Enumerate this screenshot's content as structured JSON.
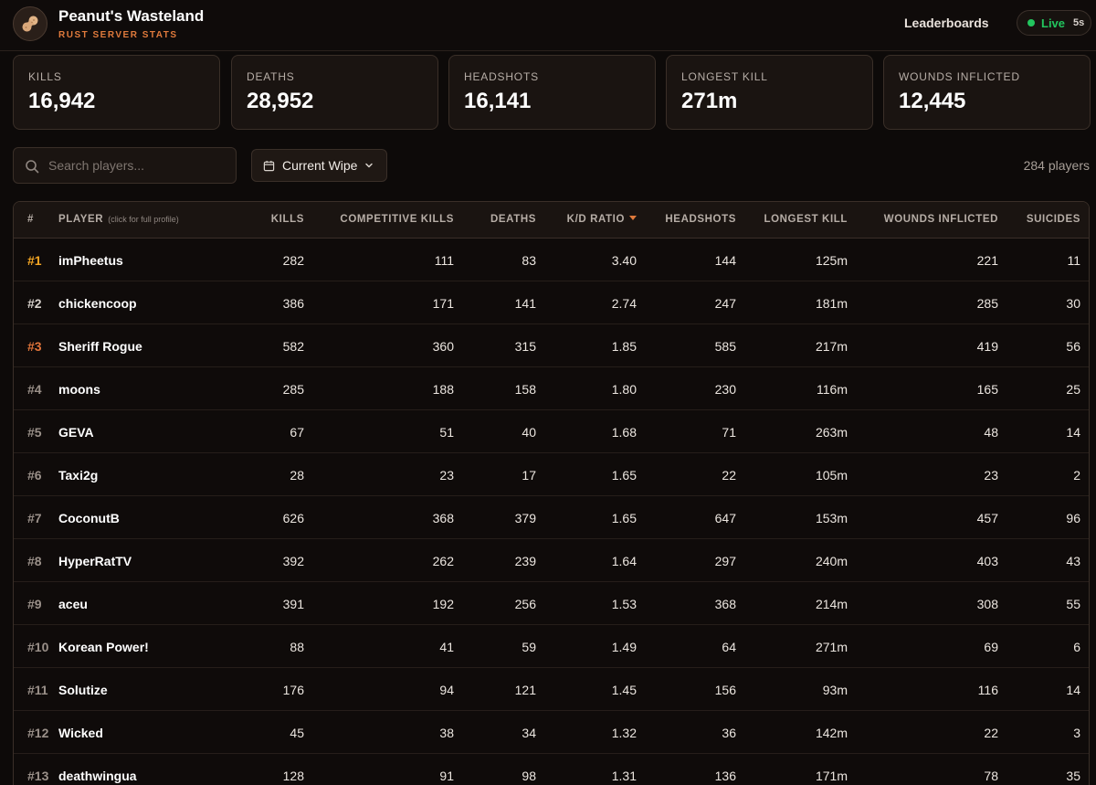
{
  "header": {
    "title": "Peanut's Wasteland",
    "subtitle": "RUST SERVER STATS",
    "nav_leaderboards": "Leaderboards",
    "live_label": "Live",
    "live_interval": "5s",
    "live_color": "#22c55e"
  },
  "stats": [
    {
      "label": "KILLS",
      "value": "16,942"
    },
    {
      "label": "DEATHS",
      "value": "28,952"
    },
    {
      "label": "HEADSHOTS",
      "value": "16,141"
    },
    {
      "label": "LONGEST KILL",
      "value": "271m"
    },
    {
      "label": "WOUNDS INFLICTED",
      "value": "12,445"
    }
  ],
  "controls": {
    "search_placeholder": "Search players...",
    "wipe_label": "Current Wipe",
    "player_count": "284 players"
  },
  "table": {
    "columns": {
      "rank": "#",
      "player": "PLAYER",
      "player_hint": "(click for full profile)",
      "kills": "KILLS",
      "competitive_kills": "COMPETITIVE KILLS",
      "deaths": "DEATHS",
      "kd": "K/D RATIO",
      "headshots": "HEADSHOTS",
      "longest_kill": "LONGEST KILL",
      "wounds": "WOUNDS INFLICTED",
      "suicides": "SUICIDES"
    },
    "sort_column": "K/D RATIO",
    "rows": [
      {
        "rank": "#1",
        "name": "imPheetus",
        "kills": "282",
        "comp": "111",
        "deaths": "83",
        "kd": "3.40",
        "hs": "144",
        "longest": "125m",
        "wounds": "221",
        "suicides": "11"
      },
      {
        "rank": "#2",
        "name": "chickencoop",
        "kills": "386",
        "comp": "171",
        "deaths": "141",
        "kd": "2.74",
        "hs": "247",
        "longest": "181m",
        "wounds": "285",
        "suicides": "30"
      },
      {
        "rank": "#3",
        "name": "Sheriff Rogue",
        "kills": "582",
        "comp": "360",
        "deaths": "315",
        "kd": "1.85",
        "hs": "585",
        "longest": "217m",
        "wounds": "419",
        "suicides": "56"
      },
      {
        "rank": "#4",
        "name": "moons",
        "kills": "285",
        "comp": "188",
        "deaths": "158",
        "kd": "1.80",
        "hs": "230",
        "longest": "116m",
        "wounds": "165",
        "suicides": "25"
      },
      {
        "rank": "#5",
        "name": "GEVA",
        "kills": "67",
        "comp": "51",
        "deaths": "40",
        "kd": "1.68",
        "hs": "71",
        "longest": "263m",
        "wounds": "48",
        "suicides": "14"
      },
      {
        "rank": "#6",
        "name": "Taxi2g",
        "kills": "28",
        "comp": "23",
        "deaths": "17",
        "kd": "1.65",
        "hs": "22",
        "longest": "105m",
        "wounds": "23",
        "suicides": "2"
      },
      {
        "rank": "#7",
        "name": "CoconutB",
        "kills": "626",
        "comp": "368",
        "deaths": "379",
        "kd": "1.65",
        "hs": "647",
        "longest": "153m",
        "wounds": "457",
        "suicides": "96"
      },
      {
        "rank": "#8",
        "name": "HyperRatTV",
        "kills": "392",
        "comp": "262",
        "deaths": "239",
        "kd": "1.64",
        "hs": "297",
        "longest": "240m",
        "wounds": "403",
        "suicides": "43"
      },
      {
        "rank": "#9",
        "name": "aceu",
        "kills": "391",
        "comp": "192",
        "deaths": "256",
        "kd": "1.53",
        "hs": "368",
        "longest": "214m",
        "wounds": "308",
        "suicides": "55"
      },
      {
        "rank": "#10",
        "name": "Korean Power!",
        "kills": "88",
        "comp": "41",
        "deaths": "59",
        "kd": "1.49",
        "hs": "64",
        "longest": "271m",
        "wounds": "69",
        "suicides": "6"
      },
      {
        "rank": "#11",
        "name": "Solutize",
        "kills": "176",
        "comp": "94",
        "deaths": "121",
        "kd": "1.45",
        "hs": "156",
        "longest": "93m",
        "wounds": "116",
        "suicides": "14"
      },
      {
        "rank": "#12",
        "name": "Wicked",
        "kills": "45",
        "comp": "38",
        "deaths": "34",
        "kd": "1.32",
        "hs": "36",
        "longest": "142m",
        "wounds": "22",
        "suicides": "3"
      },
      {
        "rank": "#13",
        "name": "deathwingua",
        "kills": "128",
        "comp": "91",
        "deaths": "98",
        "kd": "1.31",
        "hs": "136",
        "longest": "171m",
        "wounds": "78",
        "suicides": "35"
      }
    ]
  }
}
